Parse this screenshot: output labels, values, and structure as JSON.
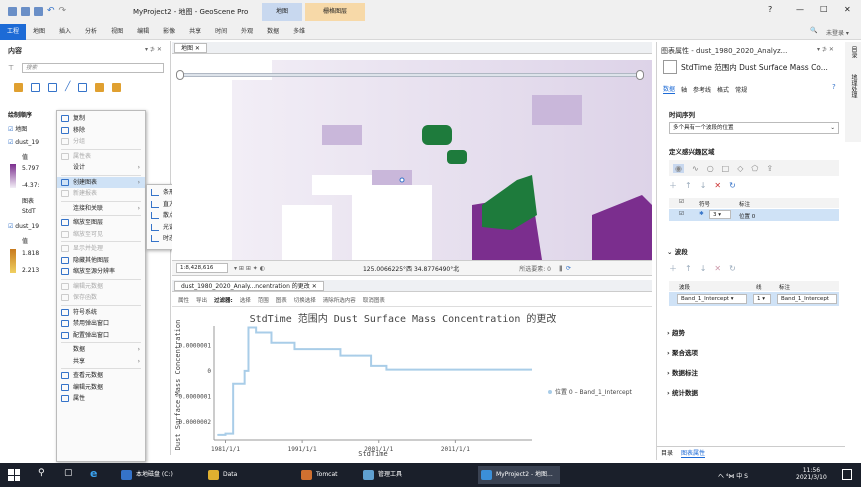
{
  "title_bar": {
    "project": "MyProject2 - 地图 - GeoScene Pro",
    "context_tab_map": "地图",
    "context_tab_raster": "栅格图层",
    "help": "?",
    "minimize": "—",
    "maximize": "□",
    "close": "✕",
    "signin": "未登录 ▾"
  },
  "ribbon": {
    "tabs": [
      "工程",
      "地图",
      "插入",
      "分析",
      "视图",
      "编辑",
      "影像",
      "共享",
      "时间",
      "外观",
      "数据",
      "多维"
    ],
    "active": "工程"
  },
  "contents": {
    "title": "内容",
    "pin": "▾ ⊅ ✕",
    "search_placeholder": "搜索",
    "draw_order": "绘制顺序",
    "items": [
      {
        "label": "地图",
        "checked": true
      },
      {
        "label": "dust_19",
        "checked": true
      },
      {
        "label": "值"
      },
      {
        "label": "5.797"
      },
      {
        "label": "-4.37:"
      },
      {
        "label": "图表"
      },
      {
        "label": "StdT"
      },
      {
        "label": "dust_19",
        "checked": true
      },
      {
        "label": "值"
      },
      {
        "label": "1.818"
      },
      {
        "label": "2.213"
      }
    ]
  },
  "context_menu": {
    "items": [
      {
        "label": "复制",
        "disabled": false,
        "icon": "copy-icon"
      },
      {
        "label": "移除",
        "disabled": false,
        "icon": "remove-icon"
      },
      {
        "label": "分组",
        "disabled": true,
        "icon": "group-icon"
      },
      {
        "label": "属性表",
        "disabled": true,
        "icon": "table-icon"
      },
      {
        "label": "设计",
        "disabled": false,
        "icon": "",
        "arrow": true
      },
      {
        "label": "创建图表",
        "disabled": false,
        "icon": "chart-icon",
        "arrow": true,
        "highlight": true
      },
      {
        "label": "新建报表",
        "disabled": true,
        "icon": "report-icon"
      },
      {
        "label": "连接和关联",
        "disabled": false,
        "icon": "",
        "arrow": true
      },
      {
        "label": "缩放至图层",
        "disabled": false,
        "icon": "zoom-layer-icon"
      },
      {
        "label": "缩放至可见",
        "disabled": true,
        "icon": "zoom-visible-icon"
      },
      {
        "label": "显示并处理",
        "disabled": true,
        "icon": "show-icon"
      },
      {
        "label": "隐藏其他图层",
        "disabled": false,
        "icon": "hide-icon"
      },
      {
        "label": "缩放至源分辨率",
        "disabled": false,
        "icon": "resolution-icon"
      },
      {
        "label": "编辑元数据",
        "disabled": true,
        "icon": "edit-meta-icon"
      },
      {
        "label": "保存函数",
        "disabled": true,
        "icon": "save-function-icon"
      },
      {
        "label": "符号系统",
        "disabled": false,
        "icon": "symbology-icon"
      },
      {
        "label": "禁用弹出窗口",
        "disabled": false,
        "icon": "popup-disable-icon"
      },
      {
        "label": "配置弹出窗口",
        "disabled": false,
        "icon": "popup-config-icon"
      },
      {
        "label": "数据",
        "disabled": false,
        "icon": "",
        "arrow": true
      },
      {
        "label": "共享",
        "disabled": false,
        "icon": "",
        "arrow": true
      },
      {
        "label": "查看元数据",
        "disabled": false,
        "icon": "view-meta-icon"
      },
      {
        "label": "编辑元数据",
        "disabled": false,
        "icon": "edit-meta2-icon"
      },
      {
        "label": "属性",
        "disabled": false,
        "icon": "properties-icon"
      }
    ]
  },
  "submenu": {
    "items": [
      "条形图",
      "直方图",
      "散点图",
      "光谱图",
      "时态图"
    ]
  },
  "map_view": {
    "tab": "地图",
    "scale": "1:8,428,616",
    "coords": "125.0066225°西 34.8776490°北",
    "selected": "所选要素: 0"
  },
  "chart_view": {
    "tab": "dust_1980_2020_Analy...ncentration 的更改",
    "toolbar": [
      "属性",
      "导出",
      "过滤器:",
      "选择",
      "范围",
      "图表",
      "切换选择",
      "清除所选内容",
      "取消图表"
    ],
    "legend_label": "位置 0 – Band_1_Intercept"
  },
  "chart_data": {
    "type": "line",
    "title": "StdTime 范围内 Dust Surface Mass Concentration 的更改",
    "xlabel": "StdTime",
    "ylabel": "Dust Surface Mass Concentration",
    "xticks": [
      "1981/1/1",
      "1991/1/1",
      "2001/1/1",
      "2011/1/1"
    ],
    "yticks": [
      "0.0000001",
      "0",
      "-0.0000001",
      "-0.0000002"
    ],
    "ylim": [
      -2.7e-07,
      1.6e-07
    ],
    "x": [
      1980.0,
      1980.6,
      1981.0,
      1981.6,
      1982.0,
      1983.5,
      1984.0,
      1985.0,
      1986.0,
      1987.0,
      1987.6,
      1988.0,
      1990.0,
      1991.0,
      1993.0,
      1995.0,
      1996.0,
      1998.0,
      2000.0,
      2002.0,
      2005.0,
      2008.0,
      2010.0,
      2012.0,
      2014.0,
      2016.0,
      2018.0,
      2020.0
    ],
    "values": [
      -2.5e-07,
      -2.5e-07,
      -2.45e-07,
      -2.45e-07,
      -5e-08,
      0,
      1.7e-07,
      1.5e-07,
      1.5e-07,
      1.1e-07,
      1.1e-07,
      1.1e-07,
      8.5e-08,
      8.5e-08,
      8.5e-08,
      8.5e-08,
      6e-08,
      6e-08,
      2e-08,
      5e-09,
      5e-09,
      5e-09,
      5e-09,
      5e-09,
      5e-09,
      5e-09,
      5e-09,
      5e-09
    ],
    "series_color": "#a9cde8"
  },
  "chart_props": {
    "title": "图表属性 - dust_1980_2020_Analyz...",
    "pin": "▾ ⊅ ✕",
    "subtitle": "StdTime 范围内 Dust Surface Mass Co...",
    "tabs": [
      "数据",
      "轴",
      "参考线",
      "格式",
      "常规"
    ],
    "time_series_label": "时间序列",
    "time_series_value": "多个具有一个波段的位置",
    "define_area_label": "定义感兴趣区域",
    "cols": [
      "符号",
      "标注"
    ],
    "row_value": "3 ▾",
    "row_label": "位置 0",
    "band_label": "波段",
    "band_cols": [
      "波段",
      "线",
      "标注"
    ],
    "band_row": [
      "Band_1_Intercept ▾",
      "1 ▾",
      "Band_1_Intercept"
    ],
    "sections": [
      "趋势",
      "聚合选项",
      "数据标注",
      "统计数据"
    ],
    "bottom_tabs": [
      "目录",
      "图表属性"
    ],
    "help": "?"
  },
  "side_tabs": [
    "目录",
    "地理处理"
  ],
  "taskbar": {
    "apps": [
      "本地磁盘 (C:)",
      "Data",
      "Tomcat",
      "管理工具",
      "MyProject2 - 地图..."
    ],
    "time": "11:56",
    "date": "2021/3/10",
    "tray": "へ ⁴⋈ 中 S"
  },
  "colors": {
    "accent": "#1d6bd6",
    "purple": "#7b2e8e",
    "green": "#1e7b3c",
    "chart_line": "#a9cde8"
  }
}
